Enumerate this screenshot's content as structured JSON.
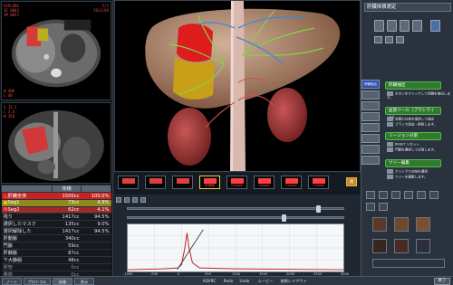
{
  "app": {
    "panel_title": "肝臓体積測定",
    "exit_button": "終了"
  },
  "left": {
    "ct_top_text": [
      "EXPLORE",
      "SE 0003",
      "IM 0057",
      "W 400",
      "L 40"
    ],
    "ct_top_right": [
      "5/5",
      "2013/09"
    ],
    "ct_bottom_text": [
      "S 15.2",
      "C 3.0",
      "W 350"
    ]
  },
  "table": {
    "headers": [
      "",
      "体積",
      ""
    ],
    "rows": [
      {
        "label": "肝臓全体",
        "vol": "1500cc",
        "pct": "100.0%",
        "style": "row-liver",
        "color": "#ff2222"
      },
      {
        "label": "Seg1",
        "vol": "73cc",
        "pct": "4.9%",
        "style": "row-seg1",
        "color": "#e0c020"
      },
      {
        "label": "Seg2",
        "vol": "62cc",
        "pct": "4.1%",
        "style": "row-seg2",
        "color": "#ff4444"
      },
      {
        "label": "残り",
        "vol": "1417cc",
        "pct": "94.5%",
        "style": "row-plain",
        "color": ""
      },
      {
        "label": "選択したマスク",
        "vol": "135cc",
        "pct": "9.0%",
        "style": "row-plain",
        "color": ""
      },
      {
        "label": "選択解除した",
        "vol": "1417cc",
        "pct": "94.5%",
        "style": "row-plain",
        "color": ""
      },
      {
        "label": "肝動脈",
        "vol": "340cc",
        "pct": "",
        "style": "row-plain",
        "color": ""
      },
      {
        "label": "門脈",
        "vol": "59cc",
        "pct": "",
        "style": "row-plain",
        "color": ""
      },
      {
        "label": "肝静脈",
        "vol": "87cc",
        "pct": "",
        "style": "row-plain",
        "color": ""
      },
      {
        "label": "下大静脈",
        "vol": "48cc",
        "pct": "",
        "style": "row-plain",
        "color": ""
      },
      {
        "label": "胆管",
        "vol": "0cc",
        "pct": "",
        "style": "row-dim",
        "color": ""
      },
      {
        "label": "腫瘍",
        "vol": "0cc",
        "pct": "",
        "style": "row-dim",
        "color": ""
      }
    ]
  },
  "thumbs": [
    {
      "label": "",
      "color": "#e04040"
    },
    {
      "label": "",
      "color": "#e04040"
    },
    {
      "label": "",
      "color": "#e04040"
    },
    {
      "label": "肝静脈",
      "color": "#ff4040"
    },
    {
      "label": "Crasse",
      "color": "#ff4040"
    },
    {
      "label": "Crasse",
      "color": "#ff4040"
    },
    {
      "label": "Crasse",
      "color": "#ff4040"
    },
    {
      "label": "Crasse",
      "color": "#ff4040"
    }
  ],
  "thumbs_extra_button": "閉",
  "graph": {
    "x_ticks": [
      "-1000",
      "-500",
      "0",
      "500",
      "1000",
      "1500",
      "2000",
      "2500",
      "3000"
    ]
  },
  "right": {
    "tabs": [
      "肝臓抽出",
      "",
      "",
      "",
      "",
      "",
      "",
      ""
    ],
    "groups": [
      {
        "title": "肝臓抽出",
        "items": [
          "ボタンをクリックして肝臓を抽出します。"
        ]
      },
      {
        "title": "血管ツール（ブラシライン）",
        "items": [
          "血管の分岐を指定して抽出",
          "ブラシで追加・削除します。"
        ]
      },
      {
        "title": "リージョン分割",
        "items": [
          "RESET リセット",
          "門脈を選択して分割します。"
        ]
      },
      {
        "title": "ツリー編集",
        "items": [
          "クリックで分岐を選択",
          "ツリーを編集します。"
        ]
      }
    ]
  },
  "bottom": {
    "tabs": [
      "ノート",
      "プロトコル",
      "画像",
      "表示"
    ],
    "buttons": [
      "ADVRC",
      "Redo",
      "Undo",
      "ムービー",
      "仮想レイアウト"
    ]
  }
}
